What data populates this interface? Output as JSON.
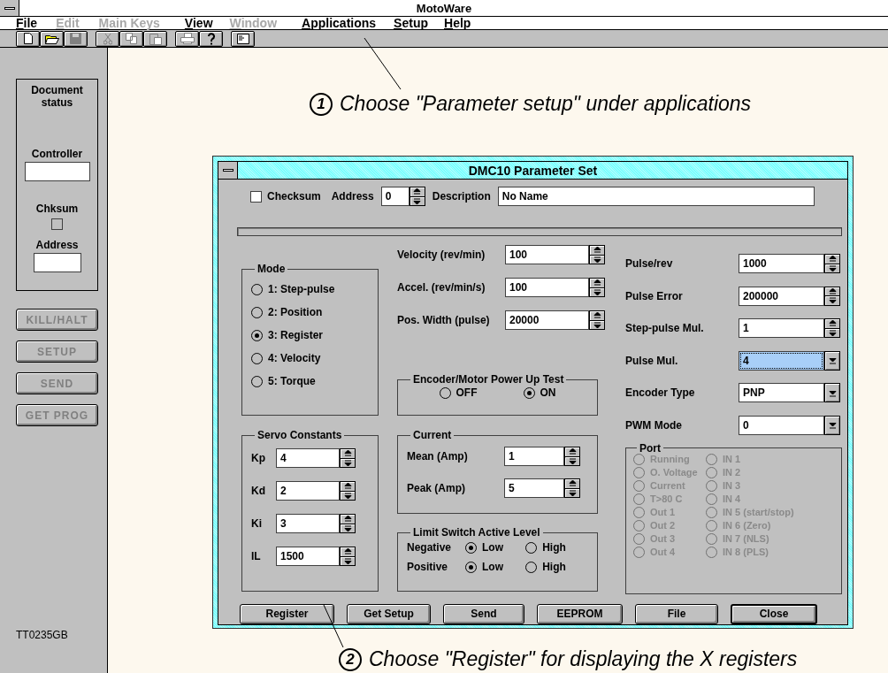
{
  "window": {
    "title": "MotoWare"
  },
  "menu": [
    {
      "label": "File",
      "disabled": false
    },
    {
      "label": "Edit",
      "disabled": true
    },
    {
      "label": "Main Keys",
      "disabled": true
    },
    {
      "label": "View",
      "disabled": false
    },
    {
      "label": "Window",
      "disabled": true
    },
    {
      "label": "Applications",
      "disabled": false
    },
    {
      "label": "Setup",
      "disabled": false
    },
    {
      "label": "Help",
      "disabled": false
    }
  ],
  "toolbar": [
    [
      {
        "kind": "page",
        "disabled": false
      },
      {
        "kind": "folder",
        "disabled": false
      },
      {
        "kind": "disk",
        "disabled": true
      }
    ],
    [
      {
        "kind": "scissors",
        "disabled": true
      },
      {
        "kind": "copy",
        "disabled": true
      },
      {
        "kind": "clipboard",
        "disabled": true
      }
    ],
    [
      {
        "kind": "printer",
        "disabled": true
      },
      {
        "kind": "question",
        "disabled": false
      }
    ],
    [
      {
        "kind": "window",
        "disabled": false
      }
    ]
  ],
  "sidebar": {
    "status_title": "Document status",
    "controller_label": "Controller",
    "checksum_label": "Chksum",
    "checksum_checked": false,
    "address_label": "Address",
    "buttons": [
      {
        "label": "KILL/HALT",
        "disabled": true
      },
      {
        "label": "SETUP",
        "disabled": true
      },
      {
        "label": "SEND",
        "disabled": true
      },
      {
        "label": "GET PROG",
        "disabled": true
      }
    ],
    "footer": "TT0235GB"
  },
  "annotations": [
    {
      "number": "1",
      "text": "Choose \"Parameter setup\" under applications"
    },
    {
      "number": "2",
      "text": "Choose \"Register\" for displaying the X registers"
    }
  ],
  "dialog": {
    "title": "DMC10 Parameter Set",
    "checksum": {
      "label": "Checksum",
      "checked": false
    },
    "address": {
      "label": "Address",
      "value": "0"
    },
    "description": {
      "label": "Description",
      "value": "No Name"
    },
    "progress": {
      "level": 0
    },
    "mode": {
      "title": "Mode",
      "options": [
        {
          "label": "1: Step-pulse",
          "selected": false
        },
        {
          "label": "2: Position",
          "selected": false
        },
        {
          "label": "3: Register",
          "selected": true
        },
        {
          "label": "4: Velocity",
          "selected": false
        },
        {
          "label": "5: Torque",
          "selected": false
        }
      ]
    },
    "motion_fields": [
      {
        "label": "Velocity (rev/min)",
        "value": "100"
      },
      {
        "label": "Accel. (rev/min/s)",
        "value": "100"
      },
      {
        "label": "Pos. Width (pulse)",
        "value": "20000"
      }
    ],
    "encoder_test": {
      "title": "Encoder/Motor Power Up Test",
      "options": [
        {
          "label": "OFF",
          "selected": false
        },
        {
          "label": "ON",
          "selected": true
        }
      ]
    },
    "settings": [
      {
        "label": "Pulse/rev",
        "value": "1000",
        "kind": "spin",
        "highlighted": false
      },
      {
        "label": "Pulse Error",
        "value": "200000",
        "kind": "spin",
        "highlighted": false
      },
      {
        "label": "Step-pulse Mul.",
        "value": "1",
        "kind": "spin",
        "highlighted": false
      },
      {
        "label": "Pulse Mul.",
        "value": "4",
        "kind": "dropdown",
        "highlighted": true
      },
      {
        "label": "Encoder Type",
        "value": "PNP",
        "kind": "dropdown",
        "highlighted": false
      },
      {
        "label": "PWM Mode",
        "value": "0",
        "kind": "dropdown",
        "highlighted": false
      }
    ],
    "servo": {
      "title": "Servo Constants",
      "fields": [
        {
          "label": "Kp",
          "value": "4"
        },
        {
          "label": "Kd",
          "value": "2"
        },
        {
          "label": "Ki",
          "value": "3"
        },
        {
          "label": "IL",
          "value": "1500"
        }
      ]
    },
    "current": {
      "title": "Current",
      "fields": [
        {
          "label": "Mean (Amp)",
          "value": "1"
        },
        {
          "label": "Peak (Amp)",
          "value": "5"
        }
      ]
    },
    "limit_switch": {
      "title": "Limit Switch Active Level",
      "rows": [
        {
          "label": "Negative",
          "options": [
            {
              "label": "Low",
              "selected": true
            },
            {
              "label": "High",
              "selected": false
            }
          ]
        },
        {
          "label": "Positive",
          "options": [
            {
              "label": "Low",
              "selected": true
            },
            {
              "label": "High",
              "selected": false
            }
          ]
        }
      ]
    },
    "port": {
      "title": "Port",
      "columns": [
        [
          {
            "label": "Running",
            "selected": false,
            "disabled": true
          },
          {
            "label": "O. Voltage",
            "selected": false,
            "disabled": true
          },
          {
            "label": "Current",
            "selected": false,
            "disabled": true
          },
          {
            "label": "T>80 C",
            "selected": false,
            "disabled": true
          },
          {
            "label": "Out 1",
            "selected": false,
            "disabled": true
          },
          {
            "label": "Out 2",
            "selected": false,
            "disabled": true
          },
          {
            "label": "Out 3",
            "selected": false,
            "disabled": true
          },
          {
            "label": "Out 4",
            "selected": false,
            "disabled": true
          }
        ],
        [
          {
            "label": "IN 1",
            "selected": false,
            "disabled": true
          },
          {
            "label": "IN 2",
            "selected": false,
            "disabled": true
          },
          {
            "label": "IN 3",
            "selected": false,
            "disabled": true
          },
          {
            "label": "IN 4",
            "selected": false,
            "disabled": true
          },
          {
            "label": "IN 5 (start/stop)",
            "selected": false,
            "disabled": true
          },
          {
            "label": "IN 6 (Zero)",
            "selected": false,
            "disabled": true
          },
          {
            "label": "IN 7 (NLS)",
            "selected": false,
            "disabled": true
          },
          {
            "label": "IN 8 (PLS)",
            "selected": false,
            "disabled": true
          }
        ]
      ]
    },
    "buttons": [
      {
        "label": "Register",
        "default": false
      },
      {
        "label": "Get Setup",
        "default": false
      },
      {
        "label": "Send",
        "default": false
      },
      {
        "label": "EEPROM",
        "default": false
      },
      {
        "label": "File",
        "default": false
      },
      {
        "label": "Close",
        "default": true
      }
    ]
  }
}
